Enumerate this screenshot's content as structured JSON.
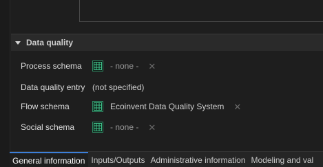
{
  "section": {
    "title": "Data quality"
  },
  "fields": [
    {
      "label": "Process schema",
      "value": "- none -"
    },
    {
      "label": "Data quality entry",
      "value": "(not specified)"
    },
    {
      "label": "Flow schema",
      "value": "Ecoinvent Data Quality System"
    },
    {
      "label": "Social schema",
      "value": "- none -"
    }
  ],
  "tabs": [
    {
      "label": "General information",
      "active": true
    },
    {
      "label": "Inputs/Outputs"
    },
    {
      "label": "Administrative information"
    },
    {
      "label": "Modeling and val"
    }
  ],
  "icons": {
    "expand": "triangle-down-icon",
    "grid": "table-grid-icon",
    "clear": "close-icon"
  },
  "colors": {
    "background": "#1e1e1e",
    "grid_icon": "#2f8a64",
    "active_tab_accent": "#3c7fd9"
  }
}
